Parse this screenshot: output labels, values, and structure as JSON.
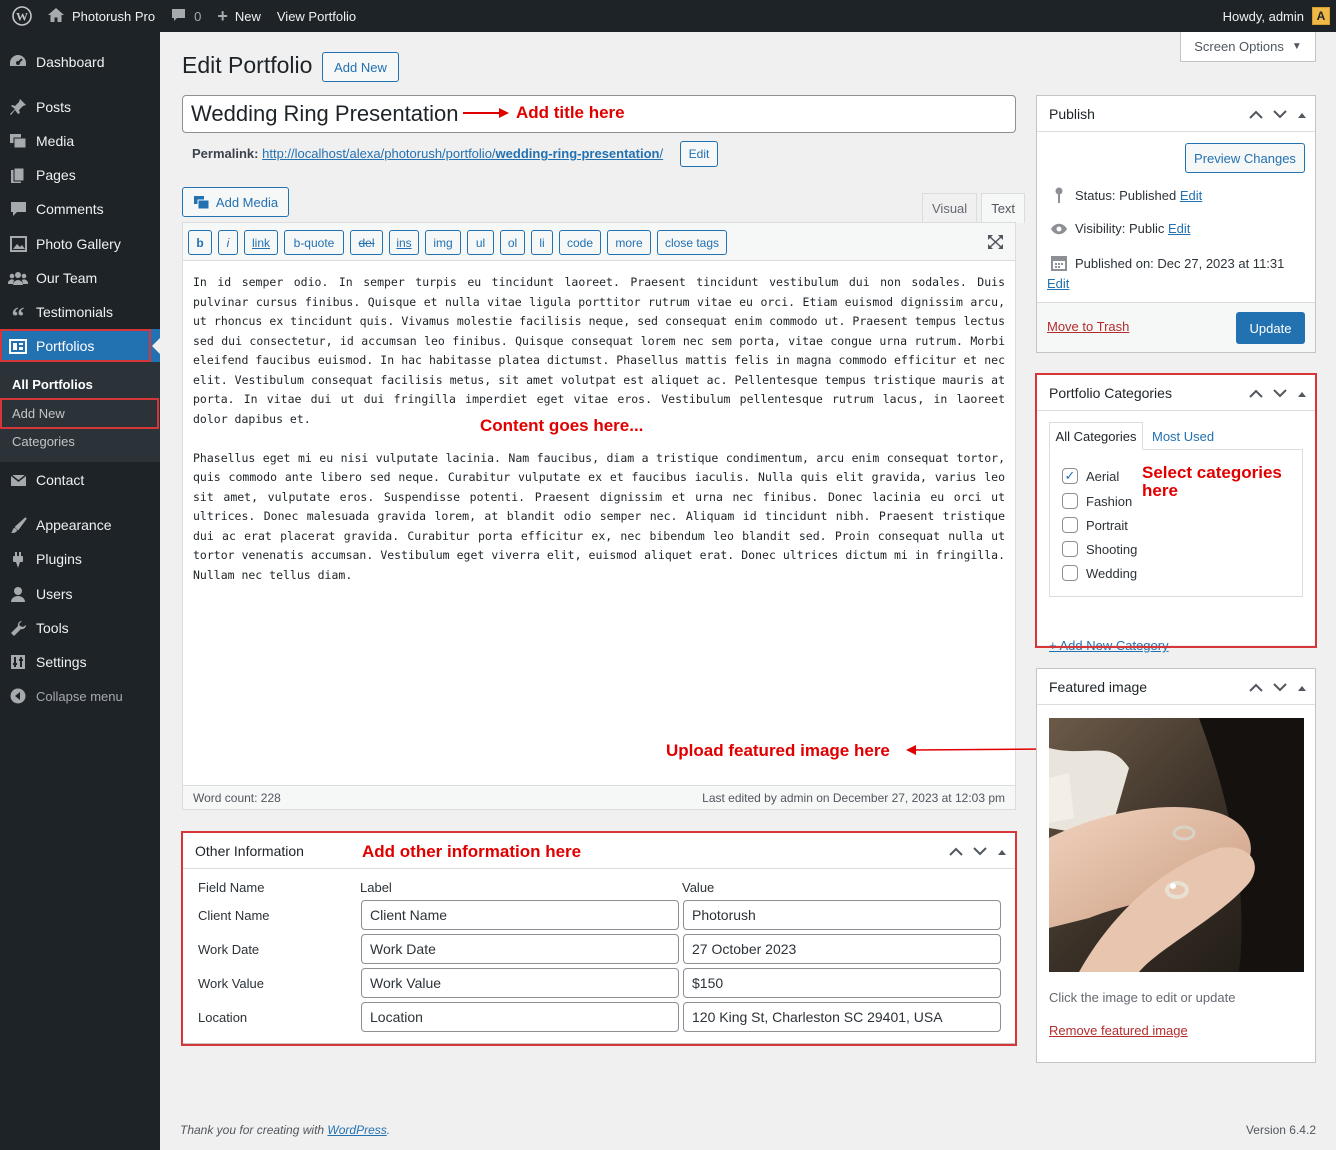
{
  "adminbar": {
    "site_name": "Photorush Pro",
    "comments_count": "0",
    "new_label": "New",
    "view_label": "View Portfolio",
    "howdy": "Howdy, admin"
  },
  "sidebar": {
    "items": [
      {
        "label": "Dashboard",
        "icon": "dashboard-icon"
      },
      {
        "label": "Posts",
        "icon": "pin-icon"
      },
      {
        "label": "Media",
        "icon": "media-icon"
      },
      {
        "label": "Pages",
        "icon": "page-icon"
      },
      {
        "label": "Comments",
        "icon": "comment-icon"
      },
      {
        "label": "Photo Gallery",
        "icon": "gallery-icon"
      },
      {
        "label": "Our Team",
        "icon": "team-icon"
      },
      {
        "label": "Testimonials",
        "icon": "quote-icon"
      },
      {
        "label": "Portfolios",
        "icon": "portfolio-icon"
      },
      {
        "label": "Contact",
        "icon": "mail-icon"
      },
      {
        "label": "Appearance",
        "icon": "brush-icon"
      },
      {
        "label": "Plugins",
        "icon": "plugin-icon"
      },
      {
        "label": "Users",
        "icon": "user-icon"
      },
      {
        "label": "Tools",
        "icon": "wrench-icon"
      },
      {
        "label": "Settings",
        "icon": "settings-icon"
      },
      {
        "label": "Collapse menu",
        "icon": "collapse-icon"
      }
    ],
    "submenu": [
      "All Portfolios",
      "Add New",
      "Categories"
    ]
  },
  "header": {
    "screen_options": "Screen Options",
    "title": "Edit Portfolio",
    "add_new": "Add New"
  },
  "post": {
    "title": "Wedding Ring Presentation",
    "permalink_label": "Permalink:",
    "permalink_base": "http://localhost/alexa/photorush/portfolio/",
    "permalink_slug": "wedding-ring-presentation",
    "permalink_end": "/",
    "edit_label": "Edit"
  },
  "editor": {
    "add_media": "Add Media",
    "tab_visual": "Visual",
    "tab_text": "Text",
    "quicktags": [
      "b",
      "i",
      "link",
      "b-quote",
      "del",
      "ins",
      "img",
      "ul",
      "ol",
      "li",
      "code",
      "more",
      "close tags"
    ],
    "paragraph1": "In id semper odio. In semper turpis eu tincidunt laoreet. Praesent tincidunt vestibulum dui non sodales. Duis pulvinar cursus finibus. Quisque et nulla vitae ligula porttitor rutrum vitae eu orci. Etiam euismod dignissim arcu, ut rhoncus ex tincidunt quis. Vivamus molestie facilisis neque, sed consequat enim commodo ut. Praesent tempus lectus sed dui consectetur, id accumsan leo finibus. Quisque consequat lorem nec sem porta, vitae congue urna rutrum. Morbi eleifend faucibus euismod. In hac habitasse platea dictumst. Phasellus mattis felis in magna commodo efficitur et nec elit. Vestibulum consequat facilisis metus, sit amet volutpat est aliquet ac. Pellentesque tempus tristique mauris at porta. In vitae dui ut dui fringilla imperdiet eget vitae eros. Vestibulum pellentesque rutrum lacus, in laoreet dolor dapibus et.",
    "paragraph2": "Phasellus eget mi eu nisi vulputate lacinia. Nam faucibus, diam a tristique condimentum, arcu enim consequat tortor, quis commodo ante libero sed neque. Curabitur vulputate ex et faucibus iaculis. Nulla quis elit gravida, varius leo sit amet, vulputate eros. Suspendisse potenti. Praesent dignissim et urna nec finibus. Donec lacinia eu orci ut ultrices. Donec malesuada gravida lorem, at blandit odio semper nec. Aliquam id tincidunt nibh. Praesent tristique dui ac erat placerat gravida. Curabitur porta efficitur ex, nec bibendum leo blandit sed. Proin consequat nulla ut tortor venenatis accumsan. Vestibulum eget viverra elit, euismod aliquet erat. Donec ultrices dictum mi in fringilla. Nullam nec tellus diam.",
    "word_count": "Word count: 228",
    "last_edited": "Last edited by admin on December 27, 2023 at 12:03 pm"
  },
  "annotations": {
    "title": "Add title here",
    "content": "Content goes here...",
    "featured": "Upload featured image here",
    "other": "Add other information here",
    "categories_line1": "Select categories",
    "categories_line2": "here"
  },
  "other_info": {
    "title": "Other Information",
    "headers": [
      "Field Name",
      "Label",
      "Value"
    ],
    "rows": [
      {
        "field": "Client Name",
        "label": "Client Name",
        "value": "Photorush"
      },
      {
        "field": "Work Date",
        "label": "Work Date",
        "value": "27 October 2023"
      },
      {
        "field": "Work Value",
        "label": "Work Value",
        "value": "$150"
      },
      {
        "field": "Location",
        "label": "Location",
        "value": "120 King St, Charleston SC 29401, USA"
      }
    ]
  },
  "publish": {
    "title": "Publish",
    "preview": "Preview Changes",
    "status_label": "Status:",
    "status_value": "Published",
    "visibility_label": "Visibility:",
    "visibility_value": "Public",
    "published_label": "Published on:",
    "published_value": "Dec 27, 2023 at 11:31",
    "edit": "Edit",
    "trash": "Move to Trash",
    "update": "Update"
  },
  "categories": {
    "title": "Portfolio Categories",
    "tab_all": "All Categories",
    "tab_used": "Most Used",
    "items": [
      {
        "label": "Aerial",
        "checked": "✓"
      },
      {
        "label": "Fashion",
        "checked": ""
      },
      {
        "label": "Portrait",
        "checked": ""
      },
      {
        "label": "Shooting",
        "checked": ""
      },
      {
        "label": "Wedding",
        "checked": ""
      }
    ],
    "add_new": "+ Add New Category"
  },
  "featured": {
    "title": "Featured image",
    "hint": "Click the image to edit or update",
    "remove": "Remove featured image"
  },
  "footer": {
    "thanks_prefix": "Thank you for creating with ",
    "wordpress": "WordPress",
    "thanks_suffix": ".",
    "version": "Version 6.4.2"
  }
}
